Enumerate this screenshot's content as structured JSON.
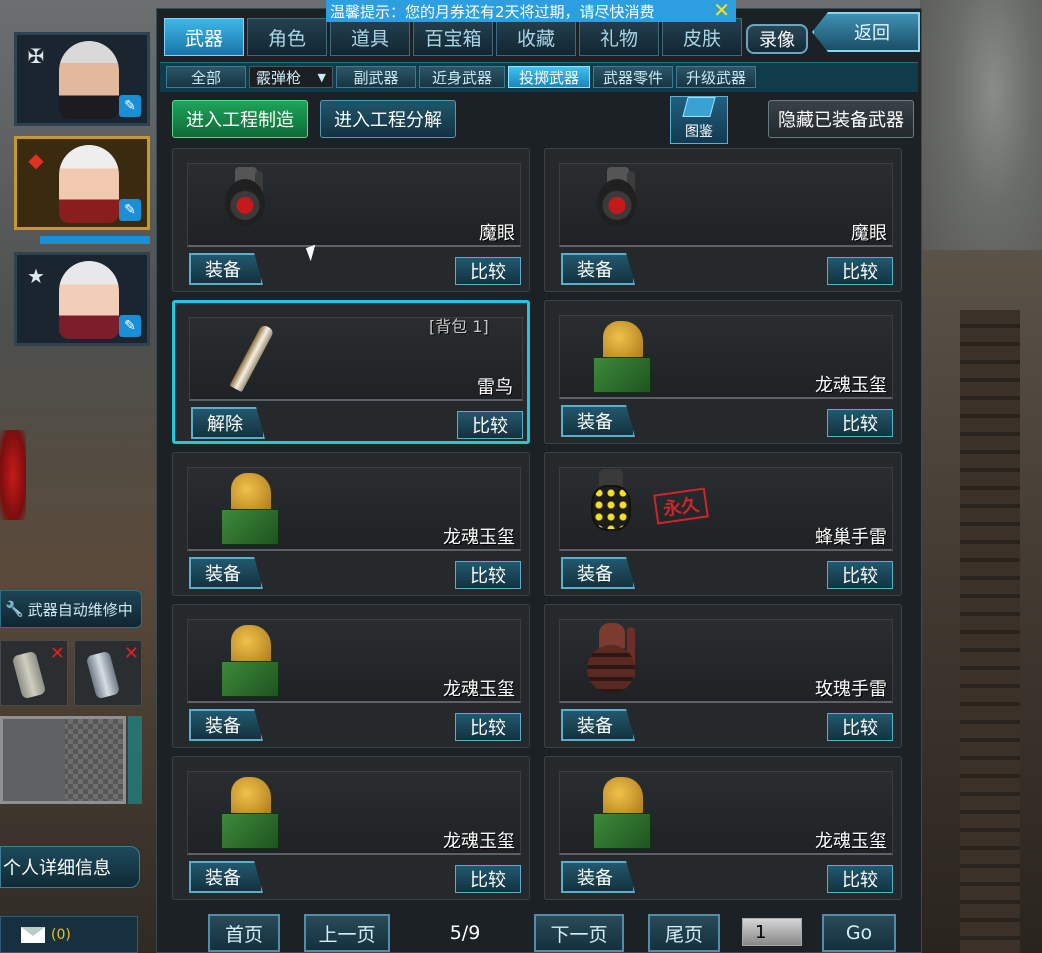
{
  "notice": {
    "text": "温馨提示：您的月券还有2天将过期，请尽快消费",
    "close": "✕"
  },
  "tabs": [
    {
      "label": "武器",
      "active": true
    },
    {
      "label": "角色"
    },
    {
      "label": "道具"
    },
    {
      "label": "百宝箱"
    },
    {
      "label": "收藏"
    },
    {
      "label": "礼物"
    },
    {
      "label": "皮肤"
    }
  ],
  "record_label": "录像",
  "back_label": "返回",
  "subtabs": {
    "all": "全部",
    "select_value": "霰弹枪",
    "secondary": "副武器",
    "melee": "近身武器",
    "throwing": "投掷武器",
    "parts": "武器零件",
    "upgrade": "升级武器"
  },
  "actions": {
    "craft": "进入工程制造",
    "decompose": "进入工程分解",
    "atlas": "图鉴",
    "hide_equipped": "隐藏已装备武器"
  },
  "items": [
    {
      "name": "魔眼",
      "icon": "grenade-icon",
      "equip": "装备",
      "compare": "比较"
    },
    {
      "name": "魔眼",
      "icon": "grenade-icon",
      "equip": "装备",
      "compare": "比较"
    },
    {
      "name": "雷鸟",
      "icon": "blade-icon",
      "equip": "解除",
      "compare": "比较",
      "tag": "[背包 1]",
      "selected": true
    },
    {
      "name": "龙魂玉玺",
      "icon": "dragon-seal-icon",
      "equip": "装备",
      "compare": "比较"
    },
    {
      "name": "龙魂玉玺",
      "icon": "dragon-seal-icon",
      "equip": "装备",
      "compare": "比较"
    },
    {
      "name": "蜂巢手雷",
      "icon": "hive-grenade-icon",
      "equip": "装备",
      "compare": "比较",
      "stamp": "永久"
    },
    {
      "name": "龙魂玉玺",
      "icon": "dragon-seal-icon",
      "equip": "装备",
      "compare": "比较"
    },
    {
      "name": "玫瑰手雷",
      "icon": "rose-grenade-icon",
      "equip": "装备",
      "compare": "比较"
    },
    {
      "name": "龙魂玉玺",
      "icon": "dragon-seal-icon",
      "equip": "装备",
      "compare": "比较"
    },
    {
      "name": "龙魂玉玺",
      "icon": "dragon-seal-icon",
      "equip": "装备",
      "compare": "比较"
    }
  ],
  "pagination": {
    "first": "首页",
    "prev": "上一页",
    "info": "5/9",
    "next": "下一页",
    "last": "尾页",
    "input_value": "1",
    "go": "Go"
  },
  "left": {
    "auto_repair": "武器自动维修中",
    "profile": "个人详细信息",
    "mail_count": "(0)"
  },
  "colors": {
    "accent": "#25c5dc",
    "tab_active": "#3fb7e8",
    "notice": "#2d9ee0"
  }
}
